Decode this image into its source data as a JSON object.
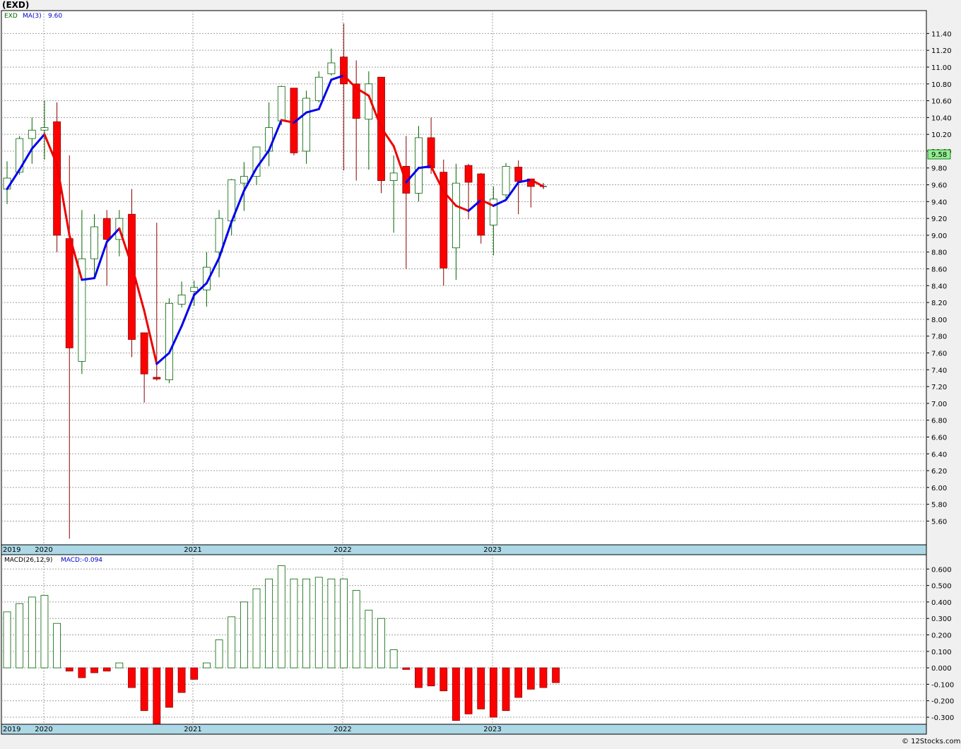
{
  "header": {
    "symbol_title": "(EXD)"
  },
  "price_panel": {
    "legend_symbol": "EXD",
    "legend_ma_label": "MA(3)",
    "legend_ma_value": "9.60",
    "last_price_badge": "9.58"
  },
  "macd_panel": {
    "legend_label": "MACD(26,12,9)",
    "legend_value_label": "MACD:-0.094"
  },
  "footer": {
    "copyright": "© 12Stocks.com"
  },
  "colors": {
    "up_candle_fill": "#ffffff",
    "up_candle_stroke": "#006400",
    "down_candle_fill": "#ff0000",
    "down_candle_stroke": "#8b0000",
    "ma_rising": "#0000ee",
    "ma_falling": "#ee0000",
    "axis_band": "#add8e6",
    "last_price_badge": "#90ee90"
  },
  "chart_data": [
    {
      "type": "candlestick",
      "timeframe": "monthly",
      "x_axis_labels": [
        "2019",
        "2020",
        "2021",
        "2022",
        "2023"
      ],
      "y_ticks": [
        "5.60",
        "5.80",
        "6.00",
        "6.20",
        "6.40",
        "6.60",
        "6.80",
        "7.00",
        "7.20",
        "7.40",
        "7.60",
        "7.80",
        "8.00",
        "8.20",
        "8.40",
        "8.60",
        "8.80",
        "9.00",
        "9.20",
        "9.40",
        "9.60",
        "9.80",
        "10.00",
        "10.20",
        "10.40",
        "10.60",
        "10.80",
        "11.00",
        "11.20",
        "11.40"
      ],
      "ylim": [
        5.36,
        11.63
      ],
      "grid": true,
      "candles": [
        {
          "o": 9.55,
          "h": 9.88,
          "l": 9.37,
          "c": 9.68
        },
        {
          "o": 9.75,
          "h": 10.18,
          "l": 9.72,
          "c": 10.15
        },
        {
          "o": 10.15,
          "h": 10.4,
          "l": 9.85,
          "c": 10.25
        },
        {
          "o": 10.25,
          "h": 10.6,
          "l": 9.9,
          "c": 10.28
        },
        {
          "o": 10.35,
          "h": 10.58,
          "l": 8.8,
          "c": 9.0
        },
        {
          "o": 8.96,
          "h": 9.95,
          "l": 5.39,
          "c": 7.66
        },
        {
          "o": 7.5,
          "h": 9.3,
          "l": 7.35,
          "c": 8.72
        },
        {
          "o": 8.72,
          "h": 9.25,
          "l": 8.5,
          "c": 9.1
        },
        {
          "o": 9.2,
          "h": 9.3,
          "l": 8.4,
          "c": 8.95
        },
        {
          "o": 8.95,
          "h": 9.3,
          "l": 8.75,
          "c": 9.2
        },
        {
          "o": 9.25,
          "h": 9.55,
          "l": 7.55,
          "c": 7.76
        },
        {
          "o": 7.84,
          "h": 7.84,
          "l": 7.01,
          "c": 7.35
        },
        {
          "o": 7.31,
          "h": 9.15,
          "l": 7.27,
          "c": 7.29
        },
        {
          "o": 7.28,
          "h": 8.25,
          "l": 7.24,
          "c": 8.19
        },
        {
          "o": 8.18,
          "h": 8.45,
          "l": 8.14,
          "c": 8.29
        },
        {
          "o": 8.33,
          "h": 8.46,
          "l": 8.16,
          "c": 8.38
        },
        {
          "o": 8.35,
          "h": 8.8,
          "l": 8.15,
          "c": 8.62
        },
        {
          "o": 8.8,
          "h": 9.3,
          "l": 8.5,
          "c": 9.2
        },
        {
          "o": 9.17,
          "h": 9.67,
          "l": 9.0,
          "c": 9.66
        },
        {
          "o": 9.62,
          "h": 9.87,
          "l": 9.29,
          "c": 9.7
        },
        {
          "o": 9.7,
          "h": 10.05,
          "l": 9.6,
          "c": 10.05
        },
        {
          "o": 10.0,
          "h": 10.58,
          "l": 9.82,
          "c": 10.28
        },
        {
          "o": 10.36,
          "h": 10.78,
          "l": 10.31,
          "c": 10.77
        },
        {
          "o": 10.75,
          "h": 10.75,
          "l": 9.95,
          "c": 9.98
        },
        {
          "o": 10.0,
          "h": 10.72,
          "l": 9.85,
          "c": 10.63
        },
        {
          "o": 10.6,
          "h": 10.95,
          "l": 10.58,
          "c": 10.88
        },
        {
          "o": 10.92,
          "h": 11.22,
          "l": 10.9,
          "c": 11.05
        },
        {
          "o": 11.12,
          "h": 11.52,
          "l": 9.77,
          "c": 10.8
        },
        {
          "o": 10.8,
          "h": 11.08,
          "l": 9.65,
          "c": 10.39
        },
        {
          "o": 10.38,
          "h": 10.95,
          "l": 9.78,
          "c": 10.8
        },
        {
          "o": 10.88,
          "h": 10.88,
          "l": 9.5,
          "c": 9.65
        },
        {
          "o": 9.65,
          "h": 9.95,
          "l": 9.03,
          "c": 9.74
        },
        {
          "o": 9.82,
          "h": 10.18,
          "l": 8.6,
          "c": 9.5
        },
        {
          "o": 9.5,
          "h": 10.3,
          "l": 9.4,
          "c": 10.16
        },
        {
          "o": 10.16,
          "h": 10.4,
          "l": 9.73,
          "c": 9.8
        },
        {
          "o": 9.75,
          "h": 9.9,
          "l": 8.4,
          "c": 8.61
        },
        {
          "o": 8.85,
          "h": 9.85,
          "l": 8.47,
          "c": 9.62
        },
        {
          "o": 9.83,
          "h": 9.85,
          "l": 9.19,
          "c": 9.63
        },
        {
          "o": 9.73,
          "h": 9.74,
          "l": 8.9,
          "c": 9.0
        },
        {
          "o": 9.12,
          "h": 9.58,
          "l": 8.76,
          "c": 9.43
        },
        {
          "o": 9.48,
          "h": 9.86,
          "l": 9.43,
          "c": 9.82
        },
        {
          "o": 9.81,
          "h": 9.89,
          "l": 9.25,
          "c": 9.64
        },
        {
          "o": 9.67,
          "h": 9.67,
          "l": 9.33,
          "c": 9.58
        },
        {
          "o": 9.58,
          "h": 9.62,
          "l": 9.55,
          "c": 9.58
        }
      ],
      "moving_average": {
        "name": "MA(3)",
        "values": [
          9.55,
          9.78,
          10.03,
          10.2,
          9.84,
          9.0,
          8.47,
          8.49,
          8.92,
          9.08,
          8.64,
          8.1,
          7.47,
          7.6,
          7.92,
          8.29,
          8.43,
          8.73,
          9.16,
          9.53,
          9.8,
          10.01,
          10.37,
          10.34,
          10.46,
          10.5,
          10.85,
          10.9,
          10.75,
          10.66,
          10.28,
          10.06,
          9.63,
          9.8,
          9.82,
          9.52,
          9.35,
          9.29,
          9.42,
          9.35,
          9.42,
          9.63,
          9.66,
          9.58
        ]
      }
    },
    {
      "type": "bar",
      "name": "MACD(26,12,9)",
      "y_ticks": [
        "-0.300",
        "-0.200",
        "-0.100",
        "0.000",
        "0.100",
        "0.200",
        "0.300",
        "0.400",
        "0.500",
        "0.600"
      ],
      "ylim": [
        -0.33,
        0.67
      ],
      "values": [
        0.34,
        0.39,
        0.43,
        0.44,
        0.27,
        -0.02,
        -0.06,
        -0.03,
        -0.02,
        0.03,
        -0.12,
        -0.26,
        -0.34,
        -0.24,
        -0.15,
        -0.07,
        0.03,
        0.17,
        0.31,
        0.4,
        0.48,
        0.54,
        0.62,
        0.54,
        0.54,
        0.55,
        0.54,
        0.54,
        0.47,
        0.35,
        0.3,
        0.11,
        -0.01,
        -0.12,
        -0.11,
        -0.14,
        -0.32,
        -0.28,
        -0.25,
        -0.3,
        -0.26,
        -0.18,
        -0.13,
        -0.12,
        -0.09
      ]
    }
  ]
}
